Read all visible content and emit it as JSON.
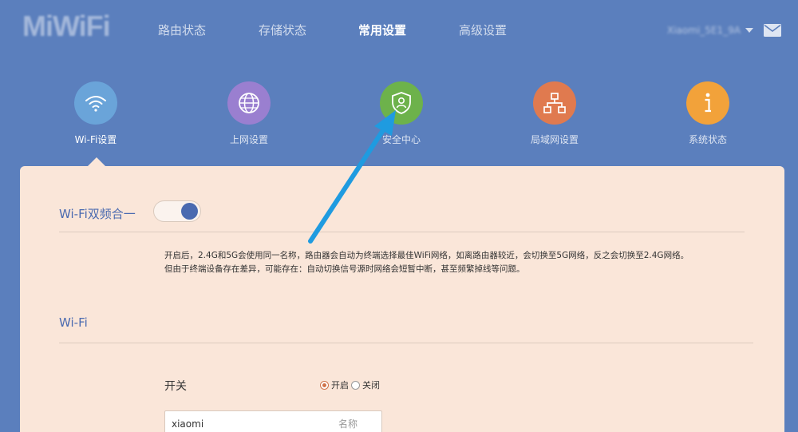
{
  "header": {
    "logo": "MiWiFi",
    "nav": [
      "路由状态",
      "存储状态",
      "常用设置",
      "高级设置"
    ],
    "active_nav": "常用设置",
    "user_name": "Xiaomi_5E1_9A"
  },
  "tiles": [
    {
      "label": "Wi-Fi设置",
      "icon": "wifi-icon",
      "color": "#6aa4d9"
    },
    {
      "label": "上网设置",
      "icon": "globe-icon",
      "color": "#9a7fd0"
    },
    {
      "label": "安全中心",
      "icon": "shield-user-icon",
      "color": "#6db24b"
    },
    {
      "label": "局域网设置",
      "icon": "network-icon",
      "color": "#e07a4f"
    },
    {
      "label": "系统状态",
      "icon": "info-icon",
      "color": "#f2a23a"
    }
  ],
  "panel": {
    "dual_band_title": "Wi-Fi双频合一",
    "dual_band_enabled": true,
    "desc_line1": "开启后，2.4G和5G会使用同一名称，路由器会自动为终端选择最佳WiFi网络，如离路由器较近，会切换至5G网络，反之会切换至2.4G网络。",
    "desc_line2": "但由于终端设备存在差异，可能存在：自动切换信号源时网络会短暂中断，甚至频繁掉线等问题。",
    "wifi_title": "Wi-Fi",
    "switch_label": "开关",
    "switch_on_label": "开启",
    "switch_off_label": "关闭",
    "switch_value": "开启",
    "name_value": "xiaomi",
    "name_hint": "名称"
  },
  "colors": {
    "background": "#5b7fbd",
    "panel": "#fae6d9",
    "accent_blue": "#4a6ab0",
    "annotation_arrow": "#1f9be0"
  }
}
